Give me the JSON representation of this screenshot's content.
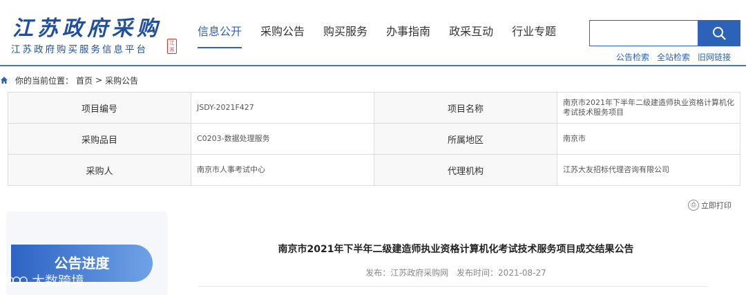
{
  "logo": {
    "calligraphy": "江苏政府采购",
    "subtitle": "江苏政府购买服务信息平台",
    "seal": "江苏"
  },
  "nav": [
    "信息公开",
    "采购公告",
    "购买服务",
    "办事指南",
    "政采互动",
    "行业专题"
  ],
  "search": {
    "placeholder": "",
    "icon": "search-icon"
  },
  "links": [
    "公告检索",
    "全站检索",
    "旧网链接"
  ],
  "breadcrumb": {
    "prefix": "你的当前位置：",
    "home": "首页",
    "sep": ">",
    "current": "采购公告"
  },
  "table": [
    {
      "l1": "项目编号",
      "v1": "JSDY-2021F427",
      "l2": "项目名称",
      "v2": "南京市2021年下半年二级建造师执业资格计算机化考试技术服务项目"
    },
    {
      "l1": "采购品目",
      "v1": "C0203-数据处理服务",
      "l2": "所属地区",
      "v2": "南京市"
    },
    {
      "l1": "采购人",
      "v1": "南京市人事考试中心",
      "l2": "代理机构",
      "v2": "江苏大友招标代理咨询有限公司"
    }
  ],
  "print_label": "立即打印",
  "side": {
    "progress_label": "公告进度"
  },
  "watermark": "大数跨境",
  "article": {
    "title": "南京市2021年下半年二级建造师执业资格计算机化考试技术服务项目成交结果公告",
    "source_label": "发布：江苏政府采购网",
    "time_label": "发布时间：2021-08-27"
  },
  "colors": {
    "accent": "#2c62b8",
    "seal": "#d9342b"
  }
}
